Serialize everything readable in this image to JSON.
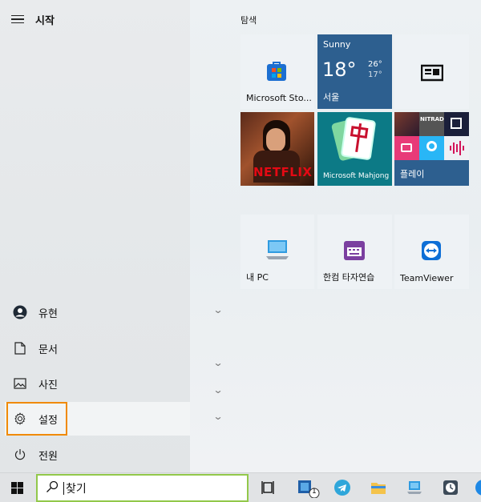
{
  "start": {
    "title": "시작"
  },
  "sidebar": {
    "items": [
      {
        "label": "유현"
      },
      {
        "label": "문서"
      },
      {
        "label": "사진"
      },
      {
        "label": "설정"
      },
      {
        "label": "전원"
      }
    ]
  },
  "panel": {
    "group_title": "탐색",
    "tiles": {
      "store": "Microsoft Sto...",
      "weather_condition": "Sunny",
      "weather_temp": "18°",
      "weather_high": "26°",
      "weather_low": "17°",
      "weather_city": "서울",
      "netflix_logo": "NETFLIX",
      "mahjong": "Microsoft Mahjong",
      "play": "플레이",
      "play_nitrado": "NITRADO",
      "mypc": "내 PC",
      "hancom": "한컴 타자연습",
      "teamviewer": "TeamViewer"
    }
  },
  "taskbar": {
    "search_query": "찾기",
    "app_badge": "1"
  },
  "colors": {
    "accent_focus": "#f08a00",
    "search_border": "#92c84a",
    "weather_bg": "#2d5f8f",
    "mahjong_bg": "#0c7a86",
    "store_icon": "#1c6fd1",
    "teamviewer_blue": "#0e6fd6"
  }
}
